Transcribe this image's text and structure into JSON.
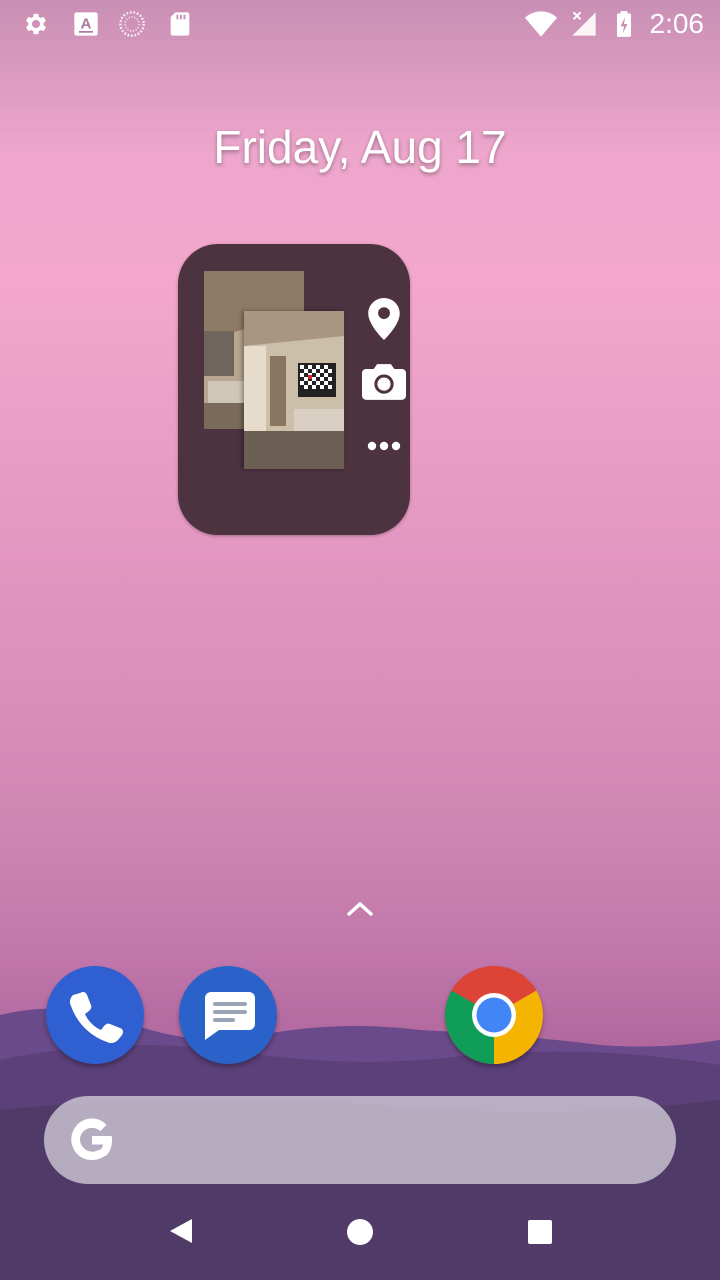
{
  "status_bar": {
    "time": "2:06",
    "left_icons": [
      "settings-gear-icon",
      "font-a-icon",
      "sync-spinner-icon",
      "sd-card-icon"
    ],
    "right_icons": [
      "wifi-icon",
      "cell-signal-no-data-icon",
      "battery-charging-icon"
    ]
  },
  "home": {
    "date": "Friday, Aug 17"
  },
  "widget": {
    "actions": [
      "location-pin-icon",
      "camera-icon",
      "more-dots-icon"
    ]
  },
  "dock": {
    "apps": [
      "Phone",
      "Messages",
      "Chrome"
    ]
  },
  "search_bar": {
    "logo": "google-g-icon"
  },
  "nav_bar": {
    "buttons": [
      "back",
      "home",
      "recents"
    ]
  },
  "colors": {
    "widget_bg": "#4d3240",
    "phone_blue": "#2f5fd0",
    "messages_blue": "#2a62c9"
  }
}
